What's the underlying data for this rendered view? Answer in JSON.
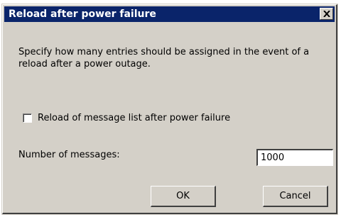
{
  "window": {
    "title": "Reload after power failure",
    "close_icon": "close-icon"
  },
  "description": "Specify how many entries should be assigned in the event of a reload after a power outage.",
  "reload_checkbox": {
    "label": "Reload of message list after power failure",
    "checked": false
  },
  "number_of_messages": {
    "label": "Number of messages:",
    "value": "1000"
  },
  "buttons": {
    "ok_label": "OK",
    "cancel_label": "Cancel"
  },
  "colors": {
    "titlebar": "#0a246a",
    "dialog_background": "#d4d0c8"
  }
}
